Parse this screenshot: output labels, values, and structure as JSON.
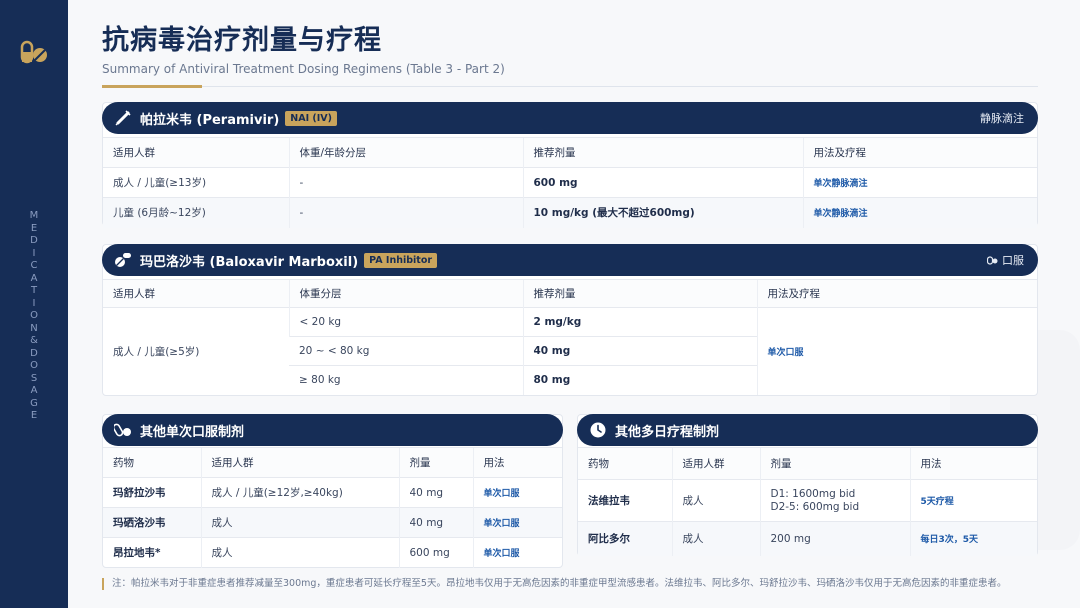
{
  "sidebar": {
    "vertical_text": [
      "M",
      "E",
      "D",
      "I",
      "C",
      "A",
      "T",
      "I",
      "O",
      "N",
      "&",
      "D",
      "O",
      "S",
      "A",
      "G",
      "E"
    ]
  },
  "header": {
    "title": "抗病毒治疗剂量与疗程",
    "subtitle": "Summary of Antiviral Treatment Dosing Regimens (Table 3 - Part 2)"
  },
  "peramivir": {
    "name": "帕拉米韦 (Peramivir)",
    "badge": "NAI (IV)",
    "route": "静脉滴注",
    "columns": [
      "适用人群",
      "体重/年龄分层",
      "推荐剂量",
      "用法及疗程"
    ],
    "rows": [
      [
        "成人 / 儿童(≥13岁)",
        "-",
        "600 mg",
        "单次静脉滴注"
      ],
      [
        "儿童 (6月龄~12岁)",
        "-",
        "10 mg/kg (最大不超过600mg)",
        "单次静脉滴注"
      ]
    ]
  },
  "baloxavir": {
    "name": "玛巴洛沙韦 (Baloxavir Marboxil)",
    "badge": "PA Inhibitor",
    "route": "口服",
    "columns": [
      "适用人群",
      "体重分层",
      "推荐剂量",
      "用法及疗程"
    ],
    "population": "成人 / 儿童(≥5岁)",
    "usage": "单次口服",
    "rows": [
      [
        "< 20 kg",
        "2 mg/kg"
      ],
      [
        "20 ~ < 80 kg",
        "40 mg"
      ],
      [
        "≥ 80 kg",
        "80 mg"
      ]
    ]
  },
  "single_oral": {
    "title": "其他单次口服制剂",
    "columns": [
      "药物",
      "适用人群",
      "剂量",
      "用法"
    ],
    "rows": [
      [
        "玛舒拉沙韦",
        "成人 / 儿童(≥12岁,≥40kg)",
        "40 mg",
        "单次口服"
      ],
      [
        "玛硒洛沙韦",
        "成人",
        "40 mg",
        "单次口服"
      ],
      [
        "昂拉地韦*",
        "成人",
        "600 mg",
        "单次口服"
      ]
    ]
  },
  "multi_day": {
    "title": "其他多日疗程制剂",
    "columns": [
      "药物",
      "适用人群",
      "剂量",
      "用法"
    ],
    "rows": [
      {
        "drug": "法维拉韦",
        "population": "成人",
        "dose1": "D1: 1600mg bid",
        "dose2": "D2-5: 600mg bid",
        "usage": "5天疗程"
      },
      {
        "drug": "阿比多尔",
        "population": "成人",
        "dose1": "200 mg",
        "dose2": "",
        "usage": "每日3次，5天"
      }
    ]
  },
  "footnote": "注：帕拉米韦对于非重症患者推荐减量至300mg，重症患者可延长疗程至5天。昂拉地韦仅用于无高危因素的非重症甲型流感患者。法维拉韦、阿比多尔、玛舒拉沙韦、玛硒洛沙韦仅用于无高危因素的非重症患者。",
  "colors": {
    "navy": "#162d56",
    "gold": "#c9a45c",
    "link": "#1e5aa8"
  }
}
